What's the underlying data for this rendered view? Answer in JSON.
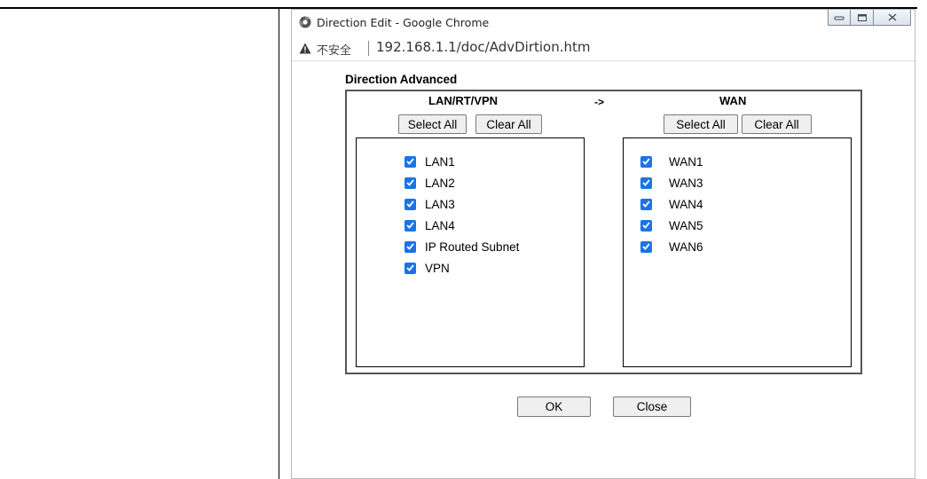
{
  "window": {
    "title": "Direction Edit - Google Chrome",
    "insecure_label": "不安全",
    "url": "192.168.1.1/doc/AdvDirtion.htm"
  },
  "page": {
    "section_title": "Direction Advanced",
    "source": {
      "header": "LAN/RT/VPN",
      "select_all_label": "Select All",
      "clear_all_label": "Clear All",
      "items": [
        {
          "label": "LAN1",
          "checked": true
        },
        {
          "label": "LAN2",
          "checked": true
        },
        {
          "label": "LAN3",
          "checked": true
        },
        {
          "label": "LAN4",
          "checked": true
        },
        {
          "label": "IP Routed Subnet",
          "checked": true
        },
        {
          "label": "VPN",
          "checked": true
        }
      ]
    },
    "arrow": "->",
    "destination": {
      "header": "WAN",
      "select_all_label": "Select All",
      "clear_all_label": "Clear All",
      "items": [
        {
          "label": "WAN1",
          "checked": true
        },
        {
          "label": "WAN3",
          "checked": true
        },
        {
          "label": "WAN4",
          "checked": true
        },
        {
          "label": "WAN5",
          "checked": true
        },
        {
          "label": "WAN6",
          "checked": true
        }
      ]
    },
    "ok_label": "OK",
    "close_label": "Close"
  },
  "colors": {
    "checkbox": "#1a73e8",
    "panel_border": "#555555",
    "button_bg": "#efefef"
  }
}
